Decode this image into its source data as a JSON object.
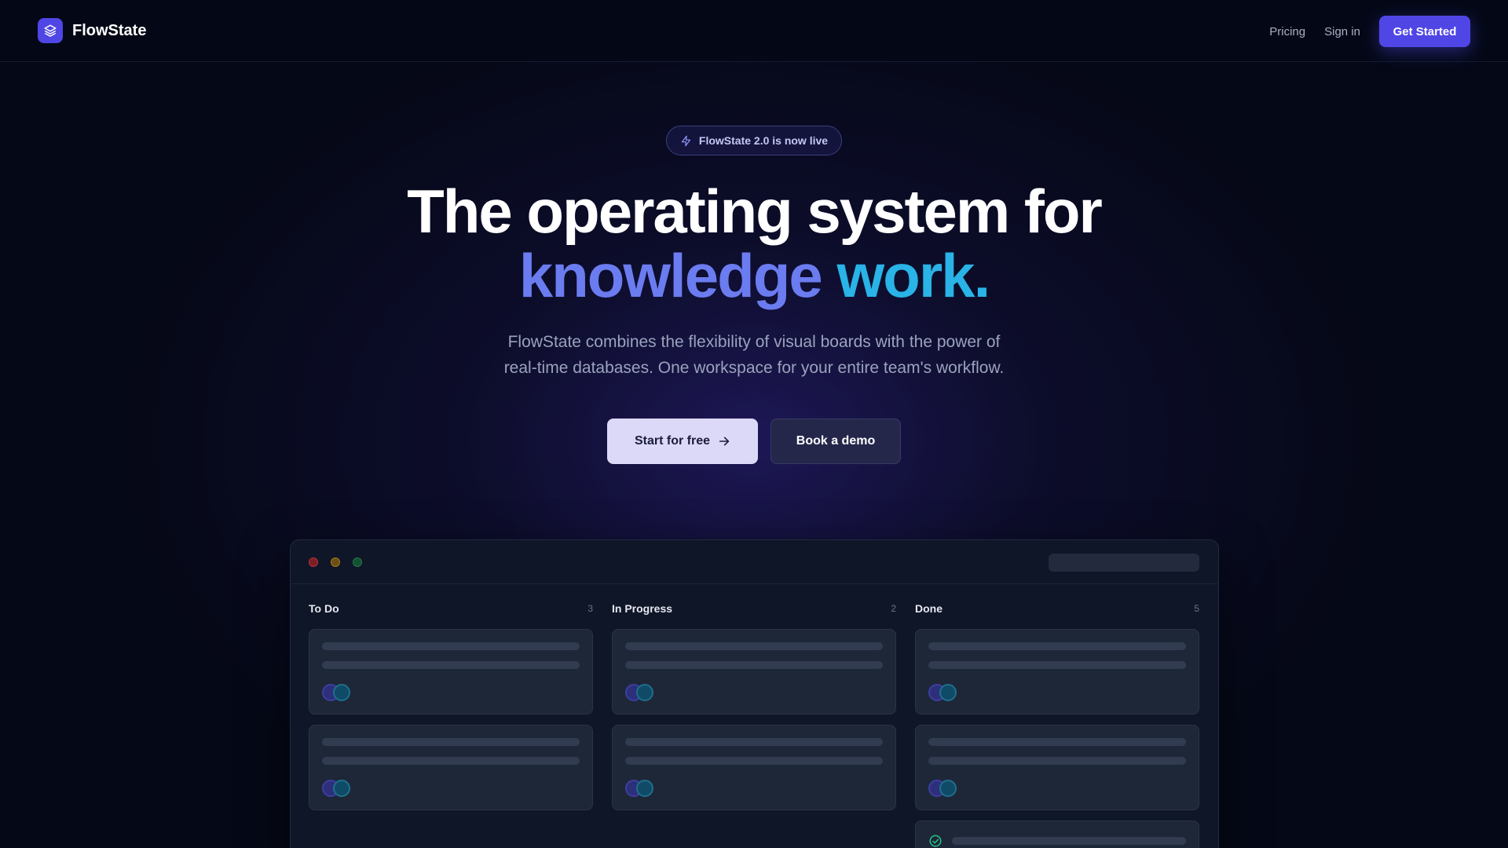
{
  "header": {
    "brand": "FlowState",
    "nav": {
      "pricing": "Pricing",
      "sign_in": "Sign in",
      "get_started": "Get Started"
    }
  },
  "hero": {
    "badge": "FlowState 2.0 is now live",
    "title_line1": "The operating system for",
    "title_line2_a": "knowledge",
    "title_line2_b": "work",
    "title_line2_c": ".",
    "subtitle_line1": "FlowState combines the flexibility of visual boards with the power of",
    "subtitle_line2": "real-time databases. One workspace for your entire team's workflow.",
    "primary_cta": "Start for free",
    "secondary_cta": "Book a demo"
  },
  "preview": {
    "columns": [
      {
        "title": "To Do",
        "count": "3"
      },
      {
        "title": "In Progress",
        "count": "2"
      },
      {
        "title": "Done",
        "count": "5"
      }
    ]
  },
  "colors": {
    "accent": "#4f46e5",
    "gradient_start": "#6b7cf0",
    "gradient_end": "#29b3e6",
    "background": "#050816"
  }
}
